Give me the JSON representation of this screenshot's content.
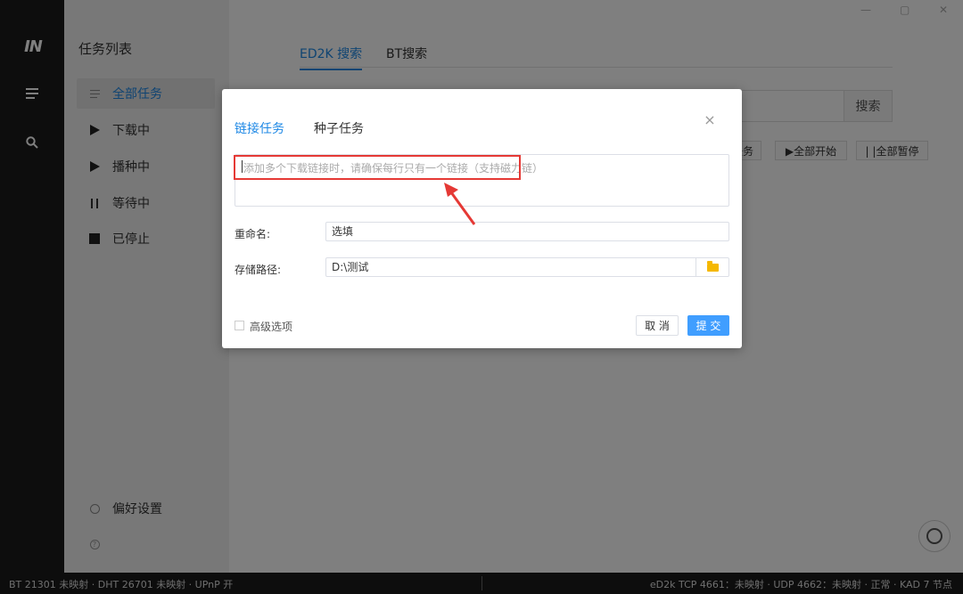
{
  "app": {
    "logo": "IN",
    "window_controls": {
      "minimize": "—",
      "maximize": "▢",
      "close": "✕"
    }
  },
  "sidebar": {
    "title": "任务列表",
    "items": [
      {
        "label": "全部任务",
        "icon": "list-icon",
        "active": true
      },
      {
        "label": "下载中",
        "icon": "play-icon"
      },
      {
        "label": "播种中",
        "icon": "play-icon"
      },
      {
        "label": "等待中",
        "icon": "pause-icon"
      },
      {
        "label": "已停止",
        "icon": "stop-icon"
      }
    ],
    "settings_label": "偏好设置"
  },
  "main": {
    "tabs": [
      {
        "label": "ED2K 搜索",
        "active": true
      },
      {
        "label": "BT搜索"
      }
    ],
    "search_button": "搜索",
    "toolbar": {
      "new_task_partial": "任务",
      "start_all": "▶全部开始",
      "pause_all": "| |全部暂停"
    }
  },
  "dialog": {
    "tabs": [
      {
        "label": "链接任务",
        "active": true
      },
      {
        "label": "种子任务"
      }
    ],
    "close": "×",
    "link_placeholder": "添加多个下载链接时，请确保每行只有一个链接（支持磁力链）",
    "rename_label": "重命名:",
    "rename_value": "选填",
    "path_label": "存储路径:",
    "path_value": "D:\\测试",
    "advanced_label": "高级选项",
    "cancel_label": "取 消",
    "submit_label": "提 交",
    "colors": {
      "accent": "#409eff",
      "highlight": "#e53935"
    }
  },
  "statusbar": {
    "left": "BT 21301 未映射 · DHT 26701 未映射 · UPnP 开",
    "right": "eD2k TCP 4661：未映射 · UDP 4662：未映射 · 正常 · KAD 7 节点"
  }
}
